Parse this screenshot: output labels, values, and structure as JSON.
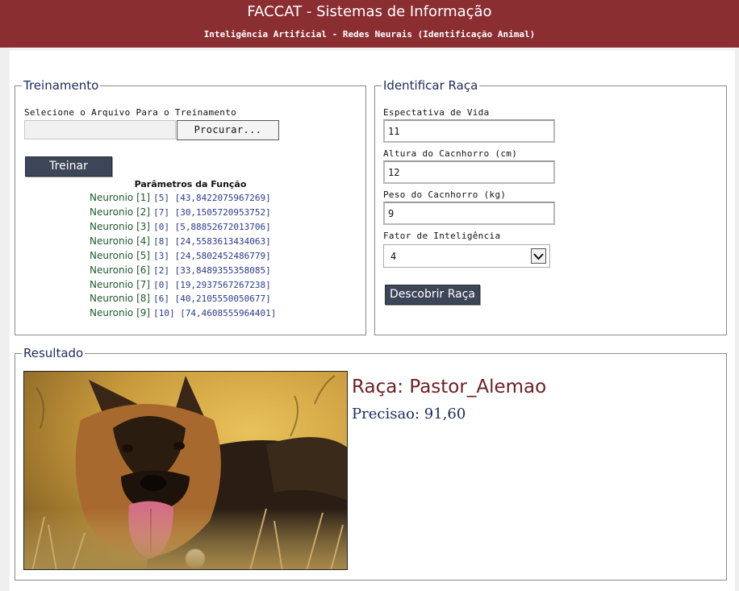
{
  "header": {
    "title": "FACCAT - Sistemas de Informação",
    "subtitle": "Inteligência Artificial - Redes Neurais (Identificação Animal)",
    "background_color": "#8b2e32"
  },
  "treinamento": {
    "legend": "Treinamento",
    "file_label": "Selecione o Arquivo Para o Treinamento",
    "file_path_value": "",
    "browse_button": "Procurar...",
    "train_button": "Treinar",
    "params_title": "Parâmetros da Função",
    "neurons": [
      {
        "name": "Neuronio [1]",
        "value": "[5] [43,8422075967269]"
      },
      {
        "name": "Neuronio [2]",
        "value": "[7] [30,1505720953752]"
      },
      {
        "name": "Neuronio [3]",
        "value": "[0] [5,88852672013706]"
      },
      {
        "name": "Neuronio [4]",
        "value": "[8] [24,5583613434063]"
      },
      {
        "name": "Neuronio [5]",
        "value": "[3] [24,5802452486779]"
      },
      {
        "name": "Neuronio [6]",
        "value": "[2] [33,8489355358085]"
      },
      {
        "name": "Neuronio [7]",
        "value": "[0] [19,2937567267238]"
      },
      {
        "name": "Neuronio [8]",
        "value": "[6] [40,2105550050677]"
      },
      {
        "name": "Neuronio [9]",
        "value": "[10] [74,4608555964401]"
      }
    ]
  },
  "identificar": {
    "legend": "Identificar Raça",
    "life_label": "Espectativa de Vida",
    "life_value": "11",
    "height_label": "Altura do Cacnhorro (cm)",
    "height_value": "12",
    "weight_label": "Peso do Cacnhorro (kg)",
    "weight_value": "9",
    "intel_label": "Fator de Inteligência",
    "intel_value": "4",
    "discover_button": "Descobrir Raça"
  },
  "resultado": {
    "legend": "Resultado",
    "raca": "Raça: Pastor_Alemao",
    "precisao": "Precisao: 91,60",
    "image_icon": "german-shepherd-photo"
  }
}
